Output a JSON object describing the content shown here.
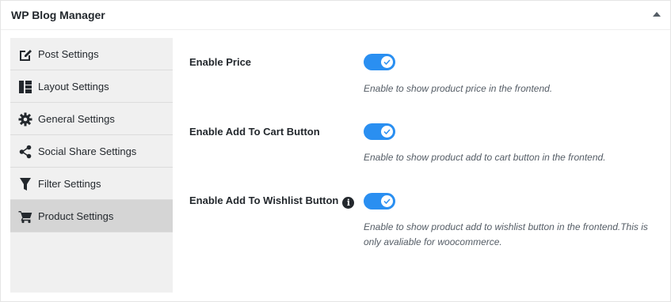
{
  "panel": {
    "title": "WP Blog Manager"
  },
  "sidebar": {
    "items": [
      {
        "label": "Post Settings",
        "icon": "edit-icon"
      },
      {
        "label": "Layout Settings",
        "icon": "layout-icon"
      },
      {
        "label": "General Settings",
        "icon": "gear-icon"
      },
      {
        "label": "Social Share Settings",
        "icon": "share-icon"
      },
      {
        "label": "Filter Settings",
        "icon": "filter-icon"
      },
      {
        "label": "Product Settings",
        "icon": "cart-icon",
        "active": true
      }
    ]
  },
  "settings": [
    {
      "label": "Enable Price",
      "enabled": true,
      "description": "Enable to show product price in the frontend."
    },
    {
      "label": "Enable Add To Cart Button",
      "enabled": true,
      "description": "Enable to show product add to cart button in the frontend."
    },
    {
      "label": "Enable Add To Wishlist Button",
      "enabled": true,
      "info_icon": "i",
      "description": "Enable to show product add to wishlist button in the frontend.This is only avaliable for woocommerce."
    }
  ],
  "colors": {
    "accent": "#2a8ff1",
    "active_tab": "#d5d5d5",
    "sidebar_bg": "#f0f0f0"
  }
}
